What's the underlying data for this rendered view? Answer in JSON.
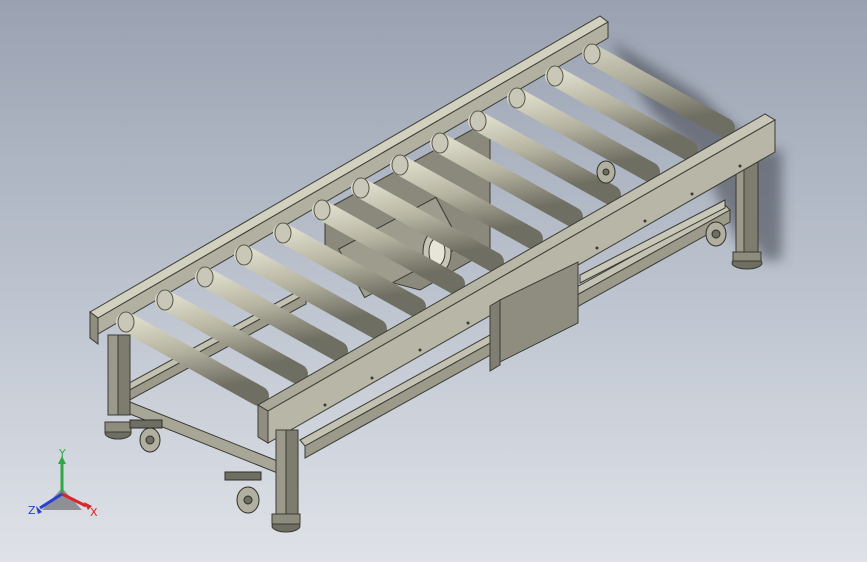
{
  "view": {
    "background_top": "#9aa2b2",
    "background_bottom": "#dfe2e8",
    "model": "roller-conveyor",
    "roller_count": 13
  },
  "triad": {
    "y_label": "Y",
    "z_label": "Z",
    "x_label": "X",
    "y_color": "#2fa84a",
    "x_color": "#d8262a",
    "z_color": "#2a3fd0"
  }
}
